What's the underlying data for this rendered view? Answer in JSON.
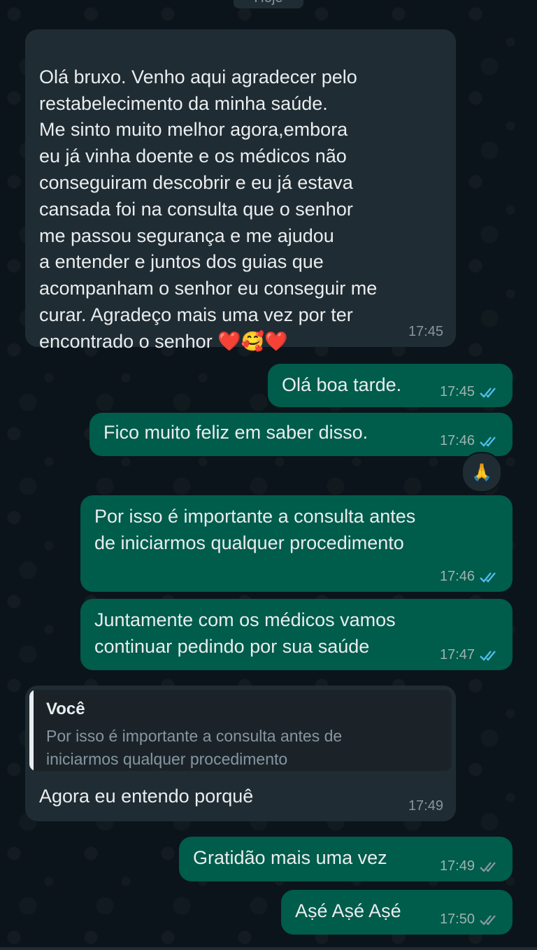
{
  "date_chip": "Hoje",
  "messages": [
    {
      "direction": "in",
      "text": "Olá bruxo. Venho aqui agradecer pelo\nrestabelecimento da minha saúde.\nMe sinto muito melhor agora,embora\neu já vinha doente e os médicos não\nconseguiram descobrir e eu já estava\ncansada foi na consulta que o senhor\nme passou segurança e me ajudou\na entender e juntos dos guias que\nacompanham o senhor eu conseguir me\ncurar. Agradeço mais uma vez por ter\nencontrado o senhor ",
      "emoji": "❤️🥰❤️",
      "time": "17:45"
    },
    {
      "direction": "out",
      "text": "Olá boa tarde.",
      "time": "17:45",
      "status": "read"
    },
    {
      "direction": "out",
      "text": "Fico muito feliz em saber disso.",
      "time": "17:46",
      "status": "read",
      "reaction": "🙏"
    },
    {
      "direction": "out",
      "text": "Por isso é importante a consulta antes\nde iniciarmos qualquer procedimento",
      "time": "17:46",
      "status": "read"
    },
    {
      "direction": "out",
      "text": "Juntamente com os médicos vamos\ncontinuar pedindo por sua saúde",
      "time": "17:47",
      "status": "read"
    },
    {
      "direction": "in",
      "quote": {
        "author": "Você",
        "text": "Por isso é importante a consulta antes de\niniciarmos qualquer procedimento"
      },
      "text": "Agora eu entendo porquê",
      "time": "17:49"
    },
    {
      "direction": "out",
      "text": "Gratidão mais uma vez",
      "time": "17:49",
      "status": "delivered"
    },
    {
      "direction": "out",
      "text": "Aṣé Aṣé Aṣé",
      "time": "17:50",
      "status": "delivered"
    }
  ],
  "colors": {
    "background": "#0b141a",
    "incoming_bubble": "#202c33",
    "outgoing_bubble": "#005c4b",
    "read_tick": "#53bdeb",
    "delivered_tick": "#8696a0"
  }
}
